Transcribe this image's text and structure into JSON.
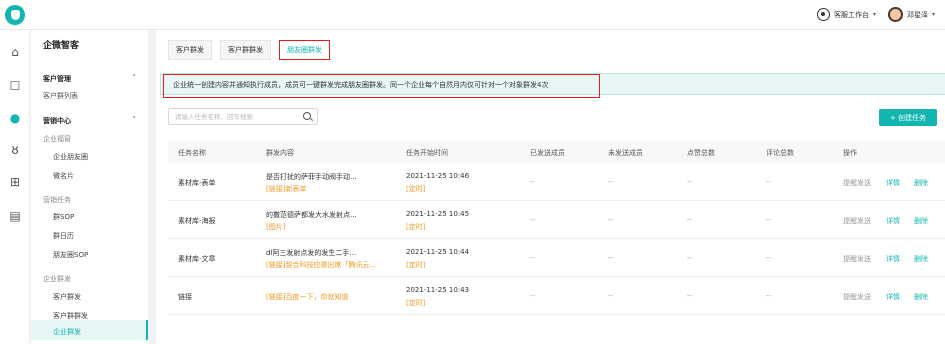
{
  "topbar": {
    "workspace_label": "客服工作台",
    "user_name": "邓星泽"
  },
  "rail": {
    "icons": [
      "home-icon",
      "chat-icon",
      "marketing-icon",
      "customers-icon",
      "org-icon",
      "report-icon"
    ]
  },
  "nav": {
    "title": "企微智客",
    "groups": [
      {
        "label": "客户管理",
        "items": [
          "客户群列表"
        ]
      },
      {
        "label": "营销中心",
        "sections": [
          {
            "label": "企业福窗",
            "items": [
              "企业朋友圈",
              "微名片"
            ]
          },
          {
            "label": "营销任务",
            "items": [
              "群SOP",
              "群日历",
              "朋友圈SOP"
            ]
          },
          {
            "label": "企业群发",
            "items": [
              "客户群发",
              "客户群群发",
              "企业群发"
            ]
          }
        ]
      }
    ]
  },
  "tabs": [
    "客户群发",
    "客户群群发",
    "朋友圈群发"
  ],
  "active_tab": 2,
  "notice": "企业统一创建内容并通知执行成员，成员可一键群发完成朋友圈群发。同一个企业每个自然月内仅可针对一个对象群发4次",
  "search": {
    "placeholder": "请输入任务名称、回车搜索"
  },
  "create_button": "+ 创建任务",
  "table": {
    "headers": [
      "任务名称",
      "群发内容",
      "任务开始时间",
      "已发送成员",
      "未发送成员",
      "点赞总数",
      "评论总数",
      "操作"
    ],
    "rows": [
      {
        "name": "素材库-表单",
        "content_title": "是否打扰的萨菲手动阀手动...",
        "content_tag": "[链接]新表单",
        "time": "2021-11-25 10:46",
        "time_tag": "[定时]",
        "sent": "--",
        "unsent": "--",
        "likes": "--",
        "comments": "--",
        "remind": "提醒发送",
        "detail": "详情",
        "delete": "删除"
      },
      {
        "name": "素材库-海报",
        "content_title": "的撒范德萨都发大水发射点...",
        "content_tag": "[图片]",
        "time": "2021-11-25 10:45",
        "time_tag": "[定时]",
        "sent": "--",
        "unsent": "--",
        "likes": "--",
        "comments": "--",
        "remind": "提醒发送",
        "detail": "详情",
        "delete": "删除"
      },
      {
        "name": "素材库-文章",
        "content_title": "dl阿三发射点发的发生二手...",
        "content_tag": "[链接]智合科技应邀出席「腾讯云...",
        "time": "2021-11-25 10:44",
        "time_tag": "[定时]",
        "sent": "--",
        "unsent": "--",
        "likes": "--",
        "comments": "--",
        "remind": "提醒发送",
        "detail": "详情",
        "delete": "删除"
      },
      {
        "name": "链接",
        "content_title": "",
        "content_tag": "[链接]百度一下，你就知道",
        "time": "2021-11-25 10:43",
        "time_tag": "[定时]",
        "sent": "--",
        "unsent": "--",
        "likes": "--",
        "comments": "--",
        "remind": "提醒发送",
        "detail": "详情",
        "delete": "删除"
      }
    ]
  },
  "colors": {
    "accent": "#12b5b0",
    "highlight_box": "#e02020",
    "tag": "#f59a23"
  }
}
